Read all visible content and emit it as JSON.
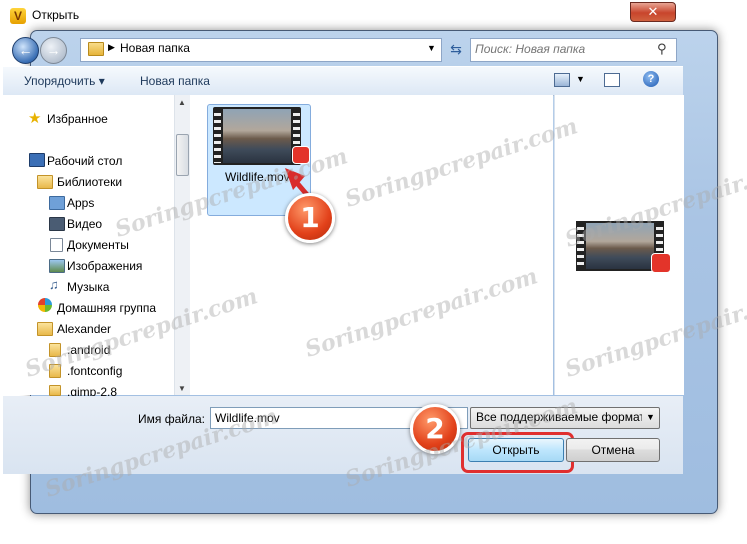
{
  "window": {
    "title": "Открыть",
    "app_icon_letter": "V",
    "close_glyph": "✕"
  },
  "navigation": {
    "back_glyph": "←",
    "forward_glyph": "→",
    "address_path": "Новая папка",
    "refresh_glyph": "⇆",
    "search_placeholder": "Поиск: Новая папка"
  },
  "toolbar": {
    "organize_label": "Упорядочить ▾",
    "new_folder_label": "Новая папка",
    "help_glyph": "?"
  },
  "sidebar": {
    "items": [
      {
        "label": "Избранное",
        "icon": "star-icon"
      },
      {
        "label": "Рабочий стол",
        "icon": "desktop-icon"
      },
      {
        "label": "Библиотеки",
        "icon": "libraries-icon"
      },
      {
        "label": "Apps",
        "icon": "apps-library-icon"
      },
      {
        "label": "Видео",
        "icon": "video-library-icon"
      },
      {
        "label": "Документы",
        "icon": "documents-library-icon"
      },
      {
        "label": "Изображения",
        "icon": "pictures-library-icon"
      },
      {
        "label": "Музыка",
        "icon": "music-library-icon"
      },
      {
        "label": "Домашняя группа",
        "icon": "homegroup-icon"
      },
      {
        "label": "Alexander",
        "icon": "user-folder-icon"
      },
      {
        "label": ".android",
        "icon": "folder-icon"
      },
      {
        "label": ".fontconfig",
        "icon": "folder-icon"
      },
      {
        "label": ".gimp-2.8",
        "icon": "folder-icon"
      }
    ]
  },
  "files": [
    {
      "name": "Wildlife.mov",
      "selected": true
    }
  ],
  "bottom": {
    "filename_label": "Имя файла:",
    "filename_value": "Wildlife.mov",
    "filetype_value": "Все поддерживаемые форматы",
    "open_label": "Открыть",
    "cancel_label": "Отмена"
  },
  "steps": {
    "step1": "1",
    "step2": "2"
  },
  "watermark": "Soringpcrepair.com",
  "colors": {
    "highlight_red": "#e02f2f",
    "selection_blue": "#cce8ff",
    "frame_blue": "#a9c4e4"
  }
}
